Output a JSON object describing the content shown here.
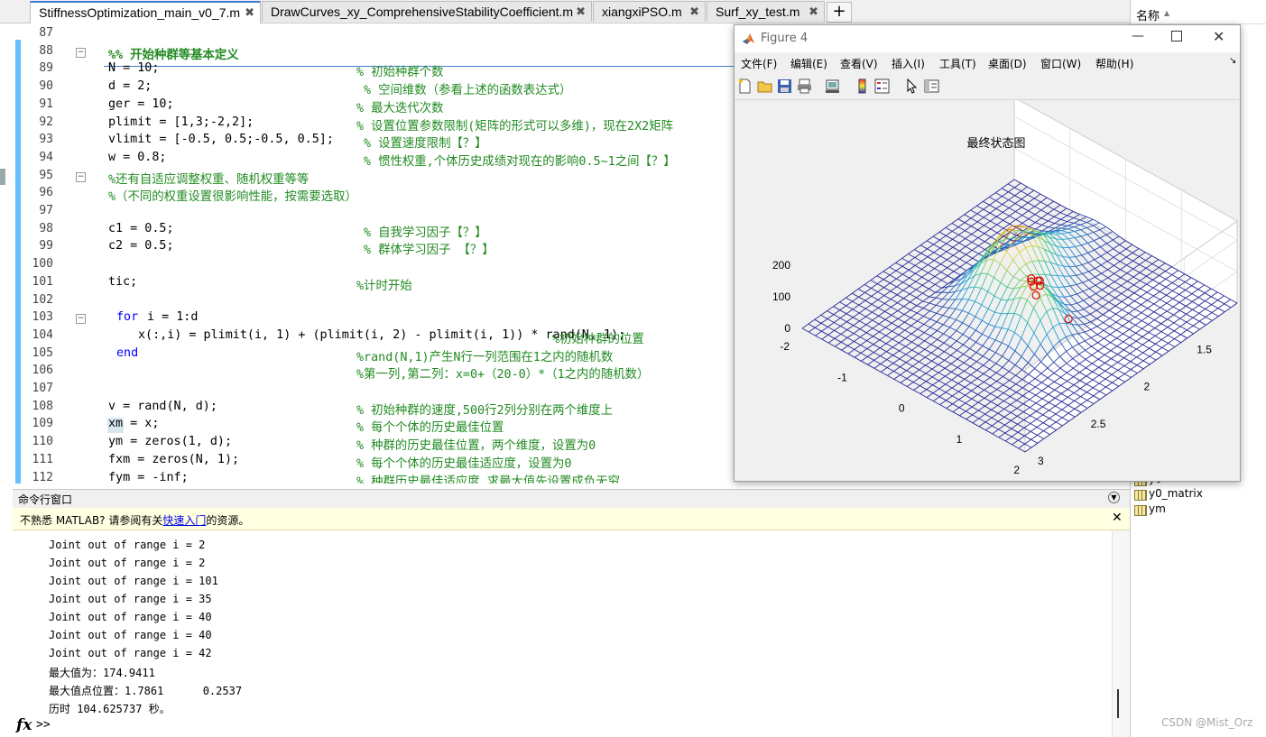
{
  "tabs": [
    {
      "label": "StiffnessOptimization_main_v0_7.m",
      "active": true
    },
    {
      "label": "DrawCurves_xy_ComprehensiveStabilityCoefficient.m",
      "active": false
    },
    {
      "label": "xiangxiPSO.m",
      "active": false
    },
    {
      "label": "Surf_xy_test.m",
      "active": false
    }
  ],
  "tab_close_glyph": "✖",
  "tab_add_glyph": "+",
  "editor": {
    "lines": [
      {
        "n": "87",
        "code": "",
        "comment": ""
      },
      {
        "n": "88",
        "code": "",
        "comment": "%% 开始种群等基本定义"
      },
      {
        "n": "89",
        "code": "N = 10;",
        "comment": "% 初始种群个数"
      },
      {
        "n": "90",
        "code": "d = 2;",
        "comment": "% 空间维数（参看上述的函数表达式）"
      },
      {
        "n": "91",
        "code": "ger = 10;",
        "comment": "% 最大迭代次数"
      },
      {
        "n": "92",
        "code": "plimit = [1,3;-2,2];",
        "comment": "% 设置位置参数限制(矩阵的形式可以多维)，现在2X2矩阵"
      },
      {
        "n": "93",
        "code": "vlimit = [-0.5, 0.5;-0.5, 0.5];",
        "comment": "% 设置速度限制【？】"
      },
      {
        "n": "94",
        "code": "w = 0.8;",
        "comment": "% 惯性权重,个体历史成绩对现在的影响0.5~1之间【？】"
      },
      {
        "n": "95",
        "code": "",
        "comment": "%还有自适应调整权重、随机权重等等"
      },
      {
        "n": "96",
        "code": "",
        "comment": "%（不同的权重设置很影响性能，按需要选取）"
      },
      {
        "n": "97",
        "code": "",
        "comment": ""
      },
      {
        "n": "98",
        "code": "c1 = 0.5;",
        "comment": "% 自我学习因子【？】"
      },
      {
        "n": "99",
        "code": "c2 = 0.5;",
        "comment": "% 群体学习因子 【？】"
      },
      {
        "n": "100",
        "code": "",
        "comment": ""
      },
      {
        "n": "101",
        "code": "tic;",
        "comment": "%计时开始"
      },
      {
        "n": "102",
        "code": "",
        "comment": ""
      },
      {
        "n": "103",
        "code": "i = 1:d",
        "keyword": "for",
        "comment": ""
      },
      {
        "n": "104",
        "code": "x(:,i) = plimit(i, 1) + (plimit(i, 2) - plimit(i, 1)) * rand(N, 1);",
        "comment": "%初始种群的位置"
      },
      {
        "n": "105",
        "code": "",
        "keyword": "end",
        "comment": "%rand(N,1)产生N行一列范围在1之内的随机数"
      },
      {
        "n": "106",
        "code": "",
        "comment": "%第一列,第二列：x=0+（20-0）*（1之内的随机数）"
      },
      {
        "n": "107",
        "code": "",
        "comment": ""
      },
      {
        "n": "108",
        "code": "v = rand(N, d);",
        "comment": "% 初始种群的速度,500行2列分别在两个维度上"
      },
      {
        "n": "109",
        "code": "xm = x;",
        "comment": "% 每个个体的历史最佳位置"
      },
      {
        "n": "110",
        "code": "ym = zeros(1, d);",
        "comment": "% 种群的历史最佳位置，两个维度，设置为0"
      },
      {
        "n": "111",
        "code": "fxm = zeros(N, 1);",
        "comment": "% 每个个体的历史最佳适应度，设置为0"
      },
      {
        "n": "112",
        "code": "fym = -inf;",
        "comment": "% 种群历史最佳适应度,求最大值先设置成负无穷"
      }
    ]
  },
  "command_window": {
    "title": "命令行窗口",
    "banner_prefix": "不熟悉 MATLAB? 请参阅有关",
    "banner_link": "快速入门",
    "banner_suffix": "的资源。",
    "output": [
      "Joint out of range i = 2",
      "Joint out of range i = 2",
      "Joint out of range i = 101",
      "Joint out of range i = 35",
      "Joint out of range i = 40",
      "Joint out of range i = 40",
      "Joint out of range i = 42",
      "最大值为：174.9411",
      "最大值点位置：1.7861      0.2537",
      "历时 104.625737 秒。"
    ],
    "fx_label": "fx",
    "prompt": ">>"
  },
  "workspace": {
    "header": "名称",
    "sort_glyph": "▲",
    "items": [
      "y0",
      "y0_matrix",
      "ym"
    ]
  },
  "watermark": "CSDN @Mist_Orz",
  "figure": {
    "title": "Figure 4",
    "menus": [
      "文件(F)",
      "编辑(E)",
      "查看(V)",
      "插入(I)",
      "工具(T)",
      "桌面(D)",
      "窗口(W)",
      "帮助(H)"
    ],
    "toolbar_icons": [
      "new-file-icon",
      "open-file-icon",
      "save-icon",
      "print-icon",
      "link-icon",
      "colorbar-icon",
      "legend-icon",
      "pointer-icon",
      "property-editor-icon"
    ],
    "plot": {
      "title": "最终状态图",
      "z_ticks": [
        "200",
        "100",
        "0"
      ],
      "y_ticks": [
        "-2",
        "-1",
        "0",
        "1",
        "2"
      ],
      "x_ticks": [
        "1",
        "1.5",
        "2",
        "2.5",
        "3"
      ]
    }
  },
  "colors": {
    "mesh_low": "#2a2a9a",
    "accent": "#3c7fd1",
    "comment": "#228b22",
    "keyword": "#0000ff",
    "marker": "#e00000"
  }
}
